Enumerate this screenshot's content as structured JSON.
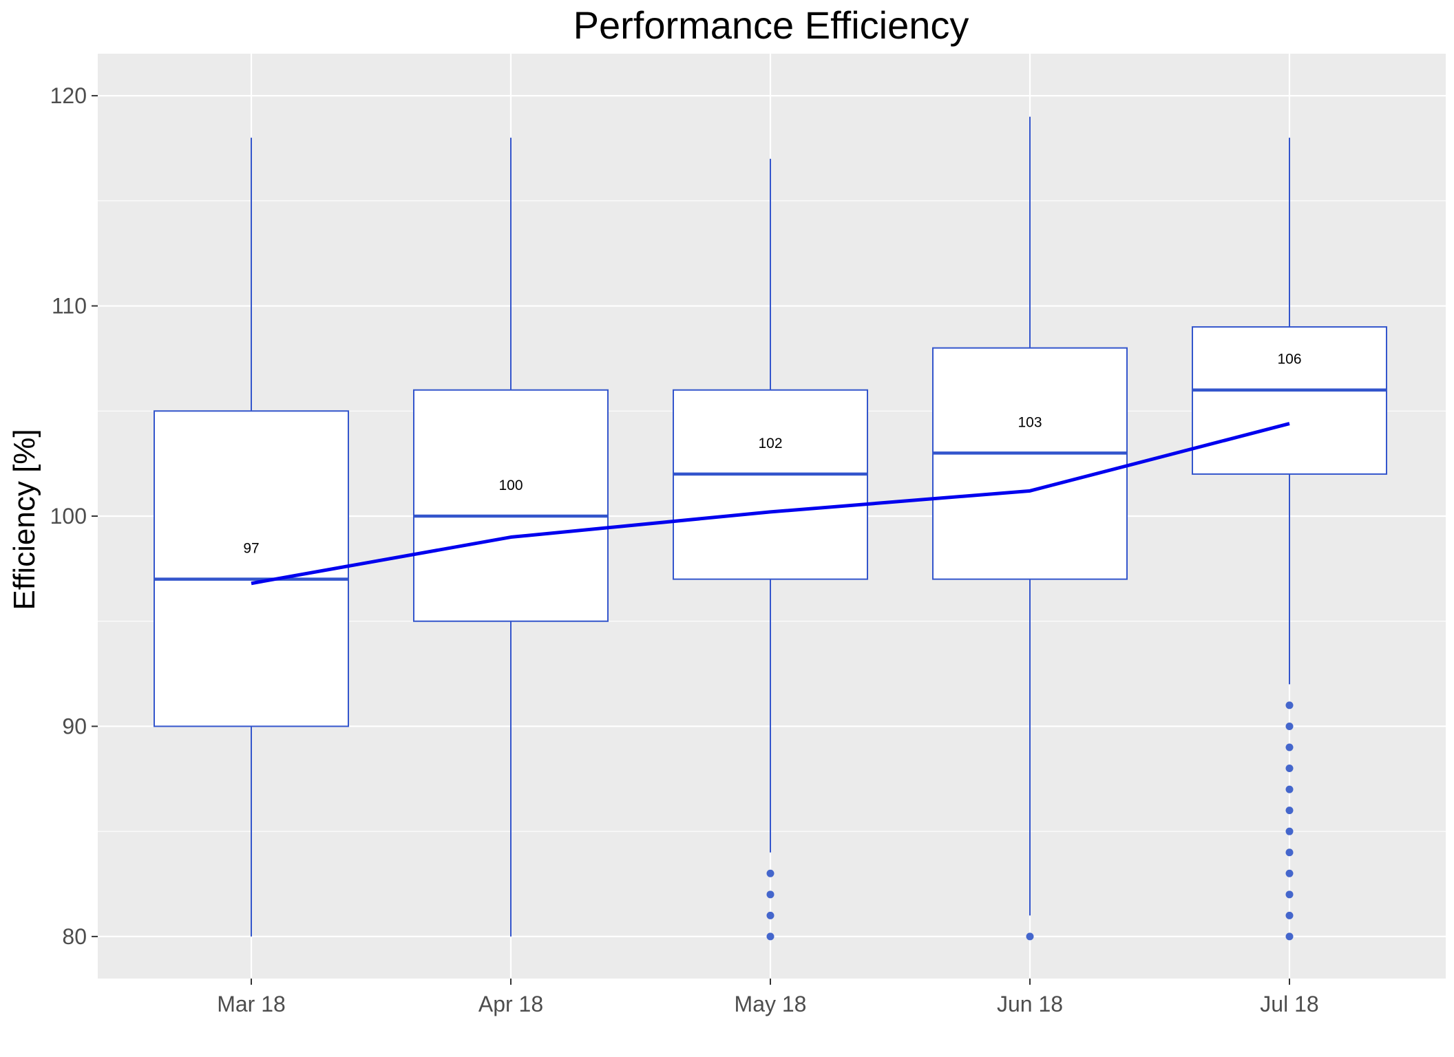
{
  "chart_data": {
    "type": "box",
    "title": "Performance Efficiency",
    "xlabel": "",
    "ylabel": "Efficiency [%]",
    "categories": [
      "Mar 18",
      "Apr 18",
      "May 18",
      "Jun 18",
      "Jul 18"
    ],
    "ylim": [
      78,
      122
    ],
    "yticks": [
      80,
      90,
      100,
      110,
      120
    ],
    "grid": true,
    "legend": "none",
    "boxes": [
      {
        "category": "Mar 18",
        "whisker_low": 80,
        "q1": 90,
        "median": 97,
        "q3": 105,
        "whisker_high": 118,
        "outliers": []
      },
      {
        "category": "Apr 18",
        "whisker_low": 80,
        "q1": 95,
        "median": 100,
        "q3": 106,
        "whisker_high": 118,
        "outliers": []
      },
      {
        "category": "May 18",
        "whisker_low": 84,
        "q1": 97,
        "median": 102,
        "q3": 106,
        "whisker_high": 117,
        "outliers": [
          80,
          81,
          82,
          83
        ]
      },
      {
        "category": "Jun 18",
        "whisker_low": 81,
        "q1": 97,
        "median": 103,
        "q3": 108,
        "whisker_high": 119,
        "outliers": [
          80
        ]
      },
      {
        "category": "Jul 18",
        "whisker_low": 92,
        "q1": 102,
        "median": 106,
        "q3": 109,
        "whisker_high": 118,
        "outliers": [
          80,
          81,
          82,
          83,
          84,
          85,
          86,
          87,
          88,
          89,
          90,
          91
        ]
      }
    ],
    "median_labels": [
      "97",
      "100",
      "102",
      "103",
      "106"
    ],
    "mean_line": {
      "values": [
        96.8,
        99.0,
        100.2,
        101.2,
        104.4
      ]
    },
    "colors": {
      "panel_background": "#ebebeb",
      "grid": "#ffffff",
      "box_outline": "#3355cc",
      "box_fill": "#ffffff",
      "outlier": "#4466cc",
      "mean_line": "#0000ee"
    }
  }
}
